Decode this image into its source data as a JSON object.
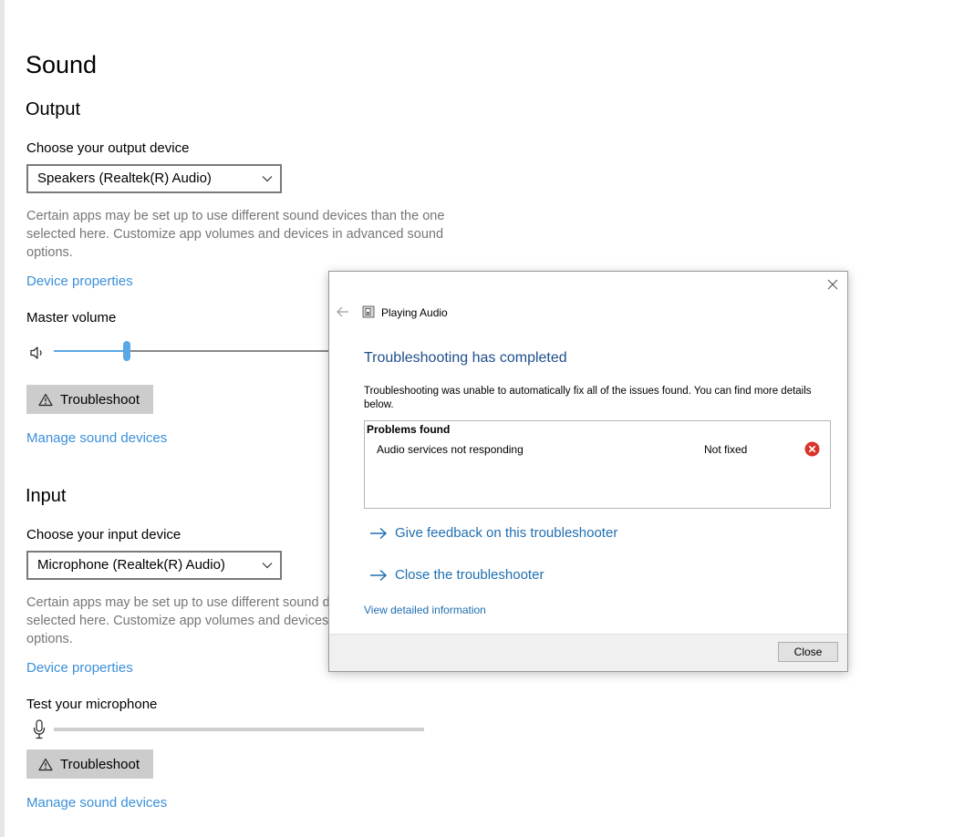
{
  "page": {
    "title": "Sound"
  },
  "output": {
    "heading": "Output",
    "choose_label": "Choose your output device",
    "device_selected": "Speakers (Realtek(R) Audio)",
    "description": "Certain apps may be set up to use different sound devices than the one selected here. Customize app volumes and devices in advanced sound options.",
    "device_properties_link": "Device properties",
    "master_volume_label": "Master volume",
    "volume_fraction": 0.25,
    "troubleshoot_label": "Troubleshoot",
    "manage_link": "Manage sound devices"
  },
  "input": {
    "heading": "Input",
    "choose_label": "Choose your input device",
    "device_selected": "Microphone (Realtek(R) Audio)",
    "description": "Certain apps may be set up to use different sound devices than the one selected here. Customize app volumes and devices in advanced sound options.",
    "device_properties_link": "Device properties",
    "test_label": "Test your microphone",
    "troubleshoot_label": "Troubleshoot",
    "manage_link": "Manage sound devices"
  },
  "dialog": {
    "title": "Playing Audio",
    "heading": "Troubleshooting has completed",
    "message": "Troubleshooting was unable to automatically fix all of the issues found. You can find more details below.",
    "problems_header": "Problems found",
    "problems": [
      {
        "name": "Audio services not responding",
        "status": "Not fixed"
      }
    ],
    "links": {
      "feedback": "Give feedback on this troubleshooter",
      "close_troubleshooter": "Close the troubleshooter"
    },
    "detail_link": "View detailed information",
    "close_button": "Close"
  },
  "colors": {
    "accent": "#5aa7e6",
    "link": "#3a8fd8",
    "dialog_heading": "#1f4e8c",
    "error": "#d9342b"
  }
}
